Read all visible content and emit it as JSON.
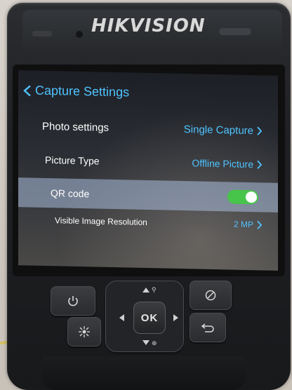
{
  "device": {
    "brand": "HIKVISION"
  },
  "screen": {
    "title": "Capture Settings",
    "rows": [
      {
        "label": "Photo settings",
        "value": "Single Capture"
      },
      {
        "label": "Picture Type",
        "value": "Offline Picture"
      },
      {
        "label": "QR code",
        "toggle": "on"
      },
      {
        "label": "Visible Image Resolution",
        "value": "2 MP"
      }
    ]
  },
  "buttons": {
    "ok_label": "OK"
  },
  "colors": {
    "accent": "#4fc3ff",
    "toggle_on": "#47c44a",
    "selected_row": "#aabedc"
  }
}
